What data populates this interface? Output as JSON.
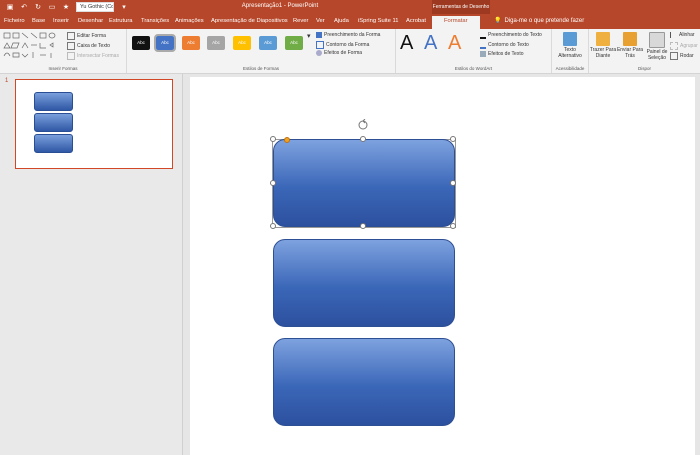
{
  "window": {
    "title": "Apresentação1 - PowerPoint",
    "context_tab_group": "Ferramentas de Desenho"
  },
  "qat": {
    "font_name": "Yu Gothic (Co"
  },
  "tabs": [
    "Ficheiro",
    "Base",
    "Inserir",
    "Desenhar",
    "Estrutura",
    "Transições",
    "Animações",
    "Apresentação de Diapositivos",
    "Rever",
    "Ver",
    "Ajuda",
    "iSpring Suite 11",
    "Acrobat",
    "Formatar"
  ],
  "active_tab": "Formatar",
  "tell_me": "Diga-me o que pretende fazer",
  "ribbon": {
    "insert_shapes": {
      "label": "Inserir Formas",
      "edit_shape": "Editar Forma",
      "text_box": "Caixa de Texto",
      "merge_shapes": "Intersectar Formas"
    },
    "shape_styles": {
      "label": "Estilos de Formas",
      "style_text": "Abc",
      "fill": "Preenchimento da Forma",
      "outline": "Contorno da Forma",
      "effects": "Efeitos de Forma"
    },
    "wordart_styles": {
      "label": "Estilos do WordArt",
      "letter": "A",
      "text_fill": "Preenchimento do Texto",
      "text_outline": "Contorno do Texto",
      "text_effects": "Efeitos de Texto"
    },
    "accessibility": {
      "label": "Acessibilidade",
      "alt_text": "Texto Alternativo"
    },
    "arrange": {
      "label": "Dispor",
      "bring_forward": "Trazer Para Diante",
      "send_backward": "Enviar Para Trás",
      "selection_pane": "Painel de Seleção",
      "align": "Alinhar",
      "group": "Agrupar",
      "rotate": "Rodar"
    }
  },
  "thumbnail": {
    "slide_number": "1"
  },
  "colors": {
    "accent": "#b7472a",
    "shape_top": "#7ea2df",
    "shape_bottom": "#2c509e"
  }
}
